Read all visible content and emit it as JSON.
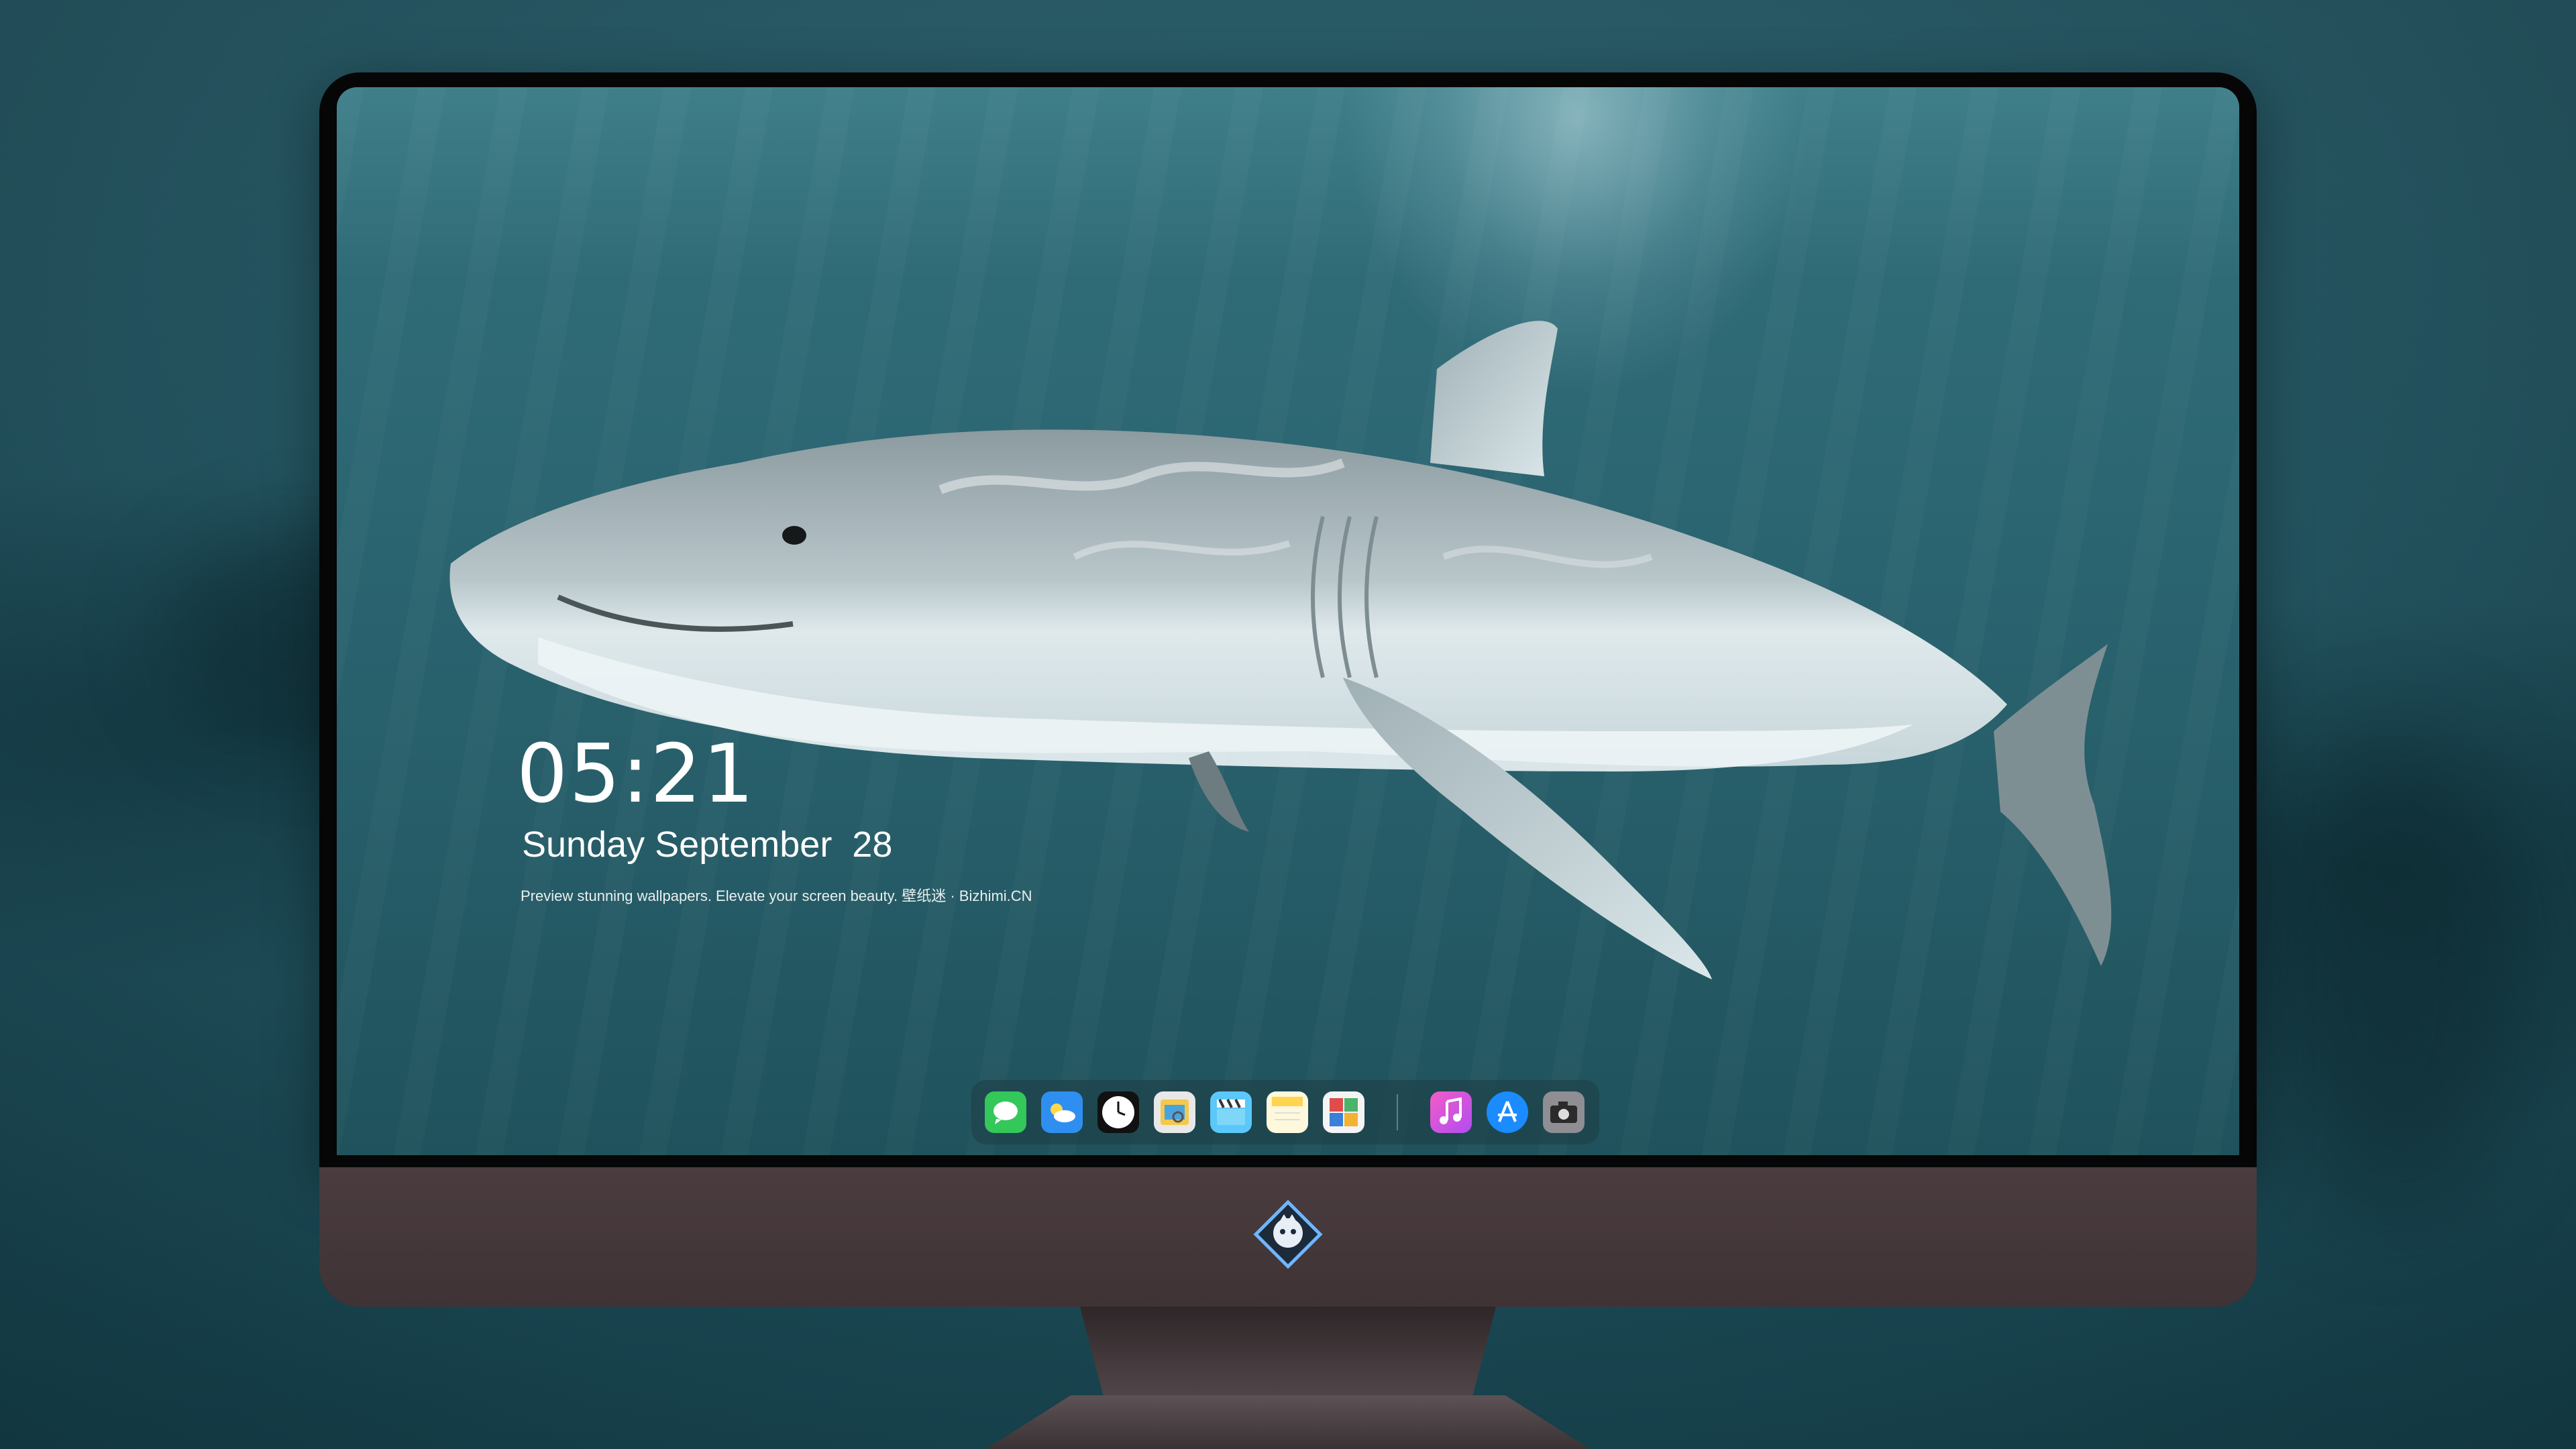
{
  "lockscreen": {
    "time": "05:21",
    "date": "Sunday September  28",
    "tagline": "Preview stunning wallpapers. Elevate your screen beauty. 壁纸迷 · Bizhimi.CN"
  },
  "dock": {
    "apps": [
      {
        "name": "Messages",
        "icon": "messages-icon",
        "color": "#34c759"
      },
      {
        "name": "Weather",
        "icon": "weather-icon",
        "color": "#2f8ff0"
      },
      {
        "name": "Clock",
        "icon": "clock-icon",
        "color": "#111111"
      },
      {
        "name": "Preview",
        "icon": "preview-icon",
        "color": "#f2c94c"
      },
      {
        "name": "Clips",
        "icon": "clips-icon",
        "color": "#5ac8fa"
      },
      {
        "name": "Notes",
        "icon": "notes-icon",
        "color": "#ffd54f"
      },
      {
        "name": "Photo Booth",
        "icon": "photo-booth-icon",
        "color": "#e04b4b"
      },
      {
        "name": "iTunes",
        "icon": "itunes-icon",
        "color": "#e845c9"
      },
      {
        "name": "App Store",
        "icon": "app-store-icon",
        "color": "#1a8cff"
      },
      {
        "name": "Camera",
        "icon": "camera-icon",
        "color": "#8e8e93"
      }
    ]
  },
  "colors": {
    "water_top": "#3f7f8a",
    "water_bottom": "#1f525c",
    "chin": "#4a3c3f",
    "bezel": "#060606"
  }
}
